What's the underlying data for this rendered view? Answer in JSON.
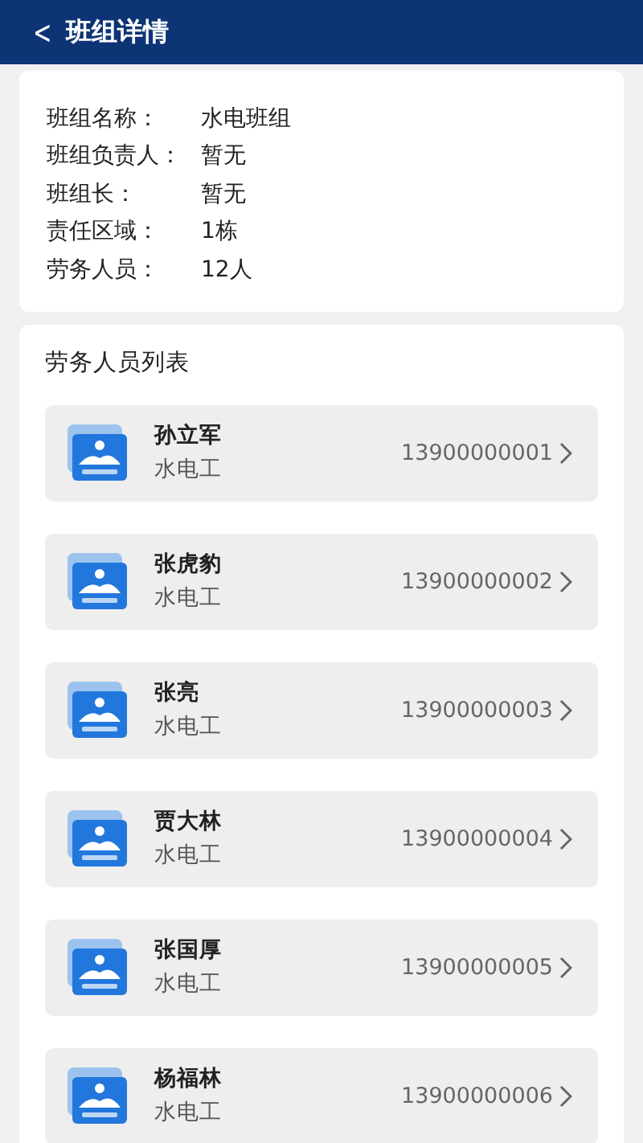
{
  "header": {
    "back": "<",
    "title": "班组详情"
  },
  "info": [
    {
      "label": "班组名称：",
      "value": "水电班组"
    },
    {
      "label": "班组负责人：",
      "value": "暂无"
    },
    {
      "label": "班组长：",
      "value": "暂无"
    },
    {
      "label": "责任区域：",
      "value": "1栋"
    },
    {
      "label": "劳务人员：",
      "value": "12人"
    }
  ],
  "workers": {
    "title": "劳务人员列表",
    "items": [
      {
        "name": "孙立军",
        "trade": "水电工",
        "phone": "13900000001"
      },
      {
        "name": "张虎豹",
        "trade": "水电工",
        "phone": "13900000002"
      },
      {
        "name": "张亮",
        "trade": "水电工",
        "phone": "13900000003"
      },
      {
        "name": "贾大林",
        "trade": "水电工",
        "phone": "13900000004"
      },
      {
        "name": "张国厚",
        "trade": "水电工",
        "phone": "13900000005"
      },
      {
        "name": "杨福林",
        "trade": "水电工",
        "phone": "13900000006"
      }
    ]
  }
}
